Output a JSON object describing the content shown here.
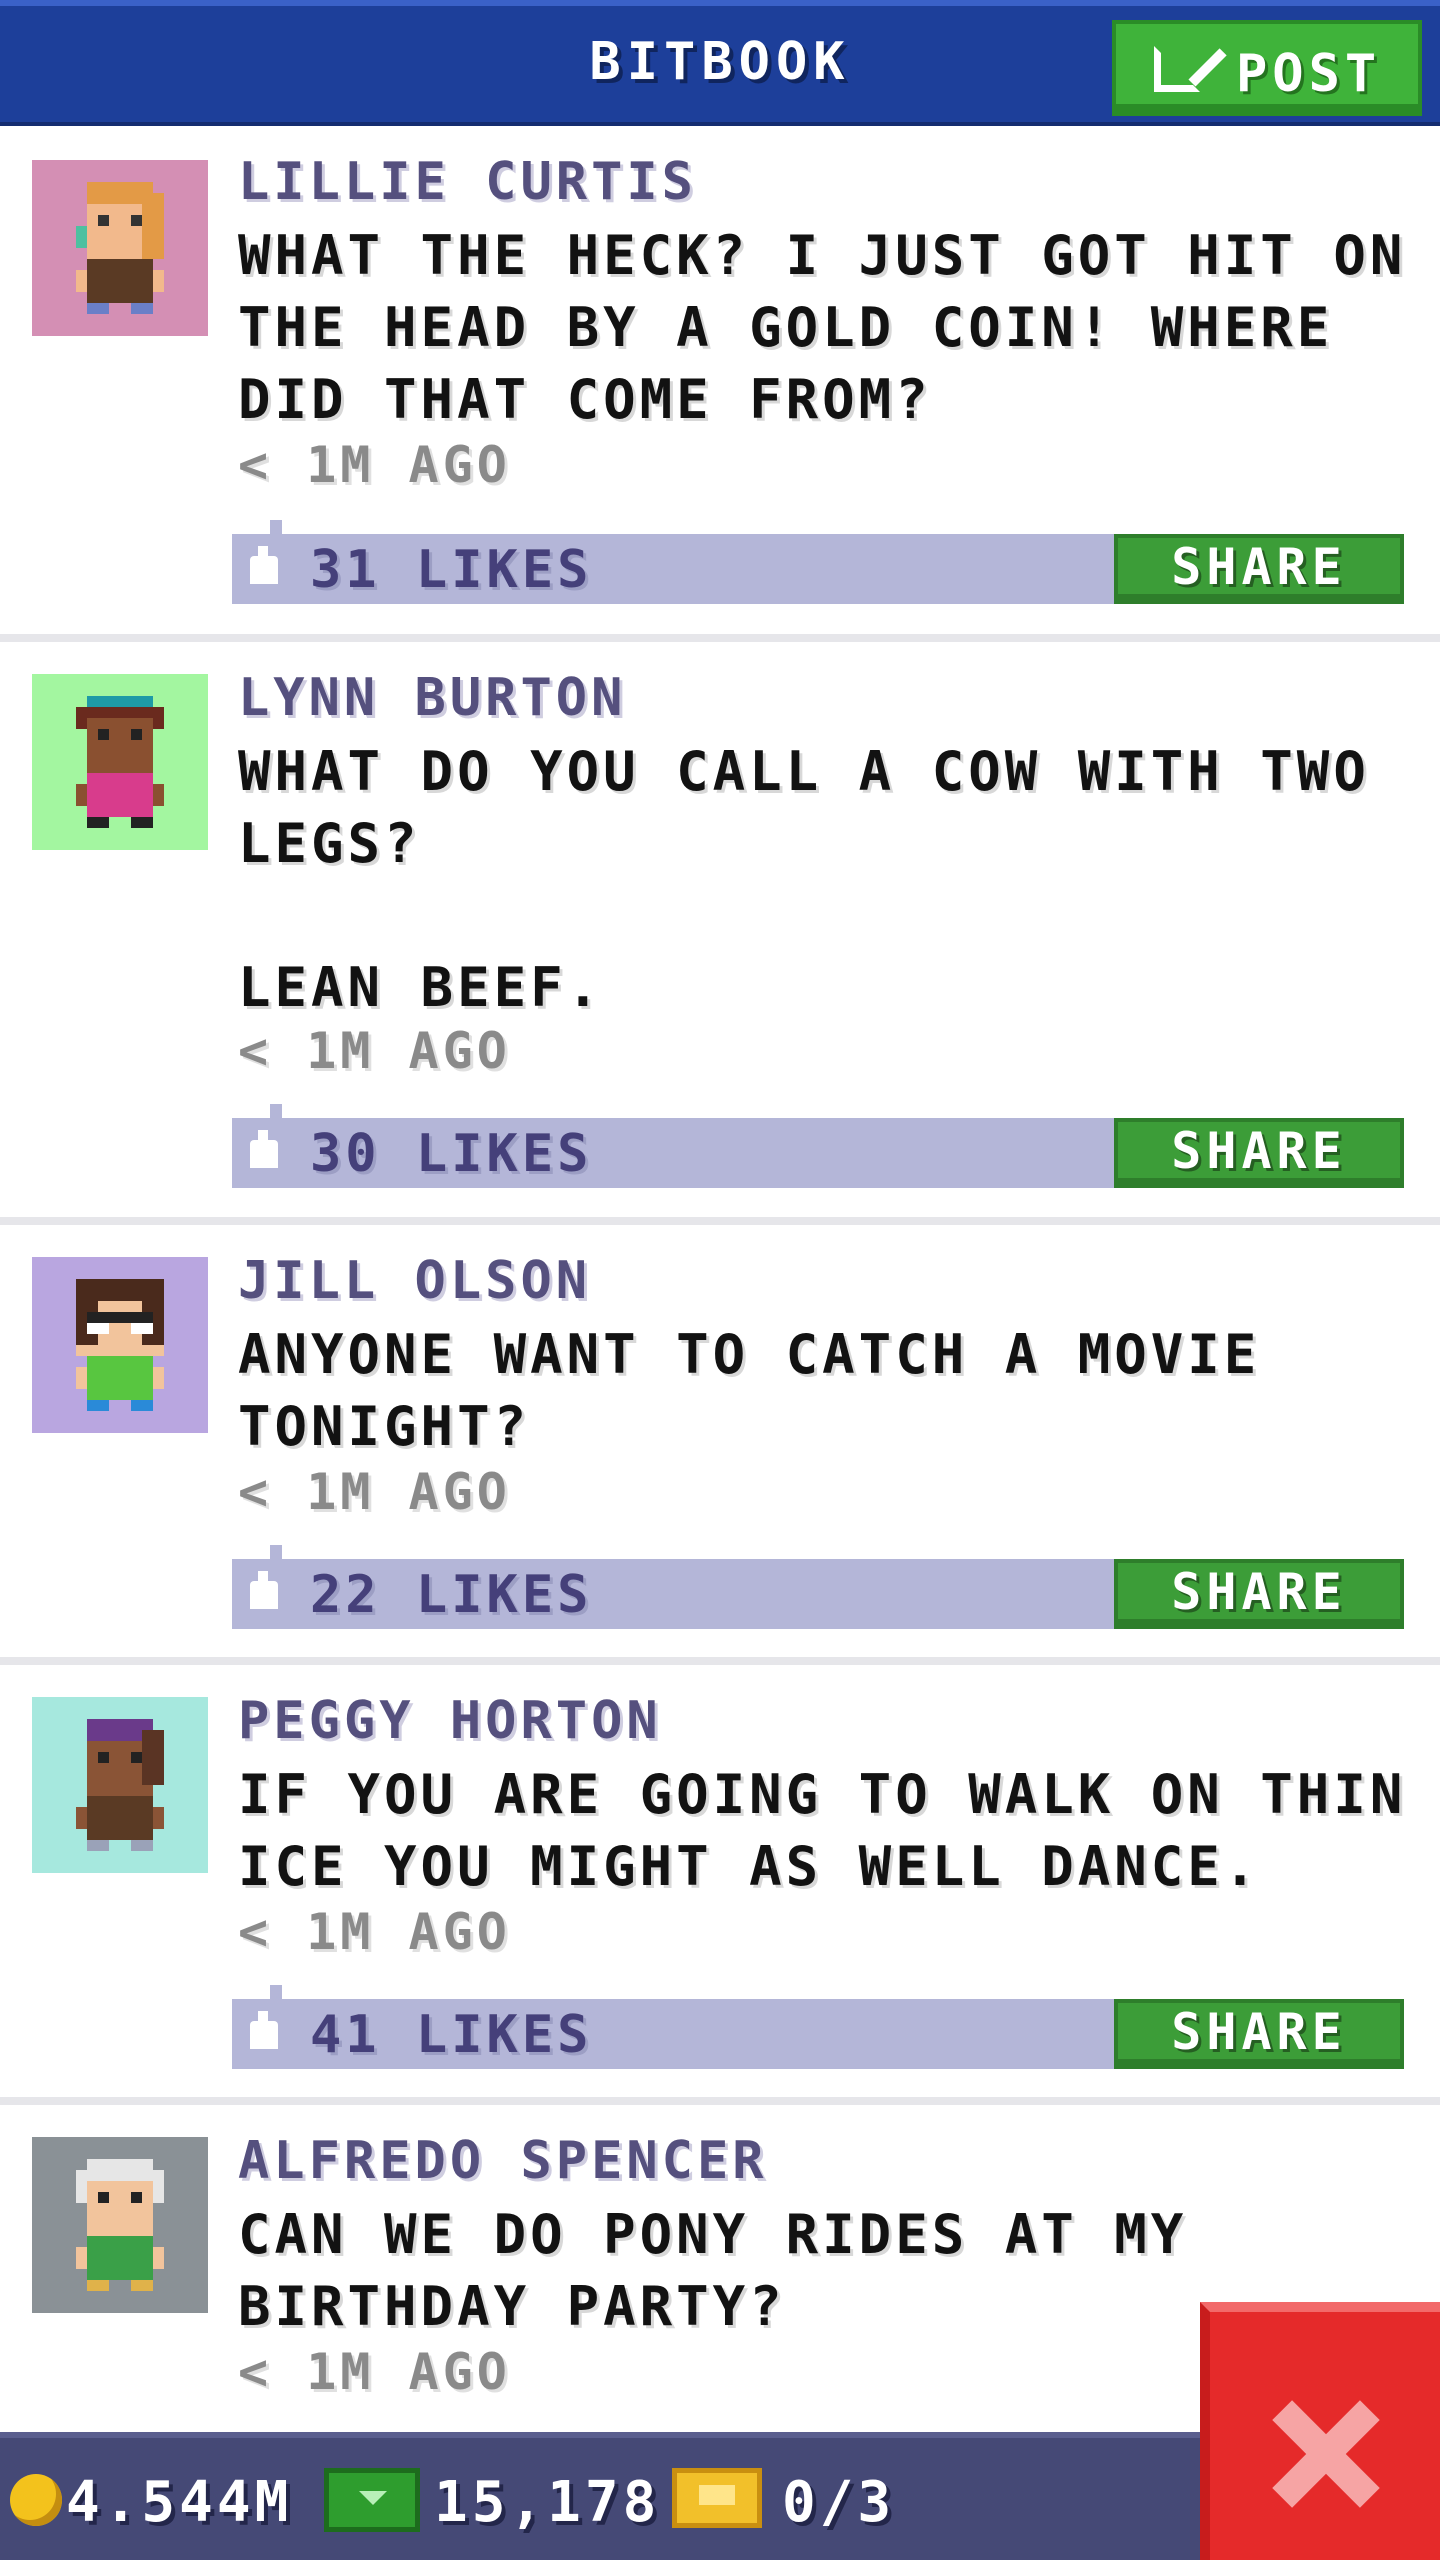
{
  "header": {
    "title": "BITBOOK",
    "post_button_label": "POST"
  },
  "posts": [
    {
      "author": "LILLIE CURTIS",
      "message": "WHAT THE HECK? I JUST GOT HIT ON THE HEAD BY A GOLD COIN! WHERE DID THAT COME FROM?",
      "time": "< 1M AGO",
      "likes": "31 LIKES",
      "share_label": "SHARE",
      "avatar_bg": "#d48fb4"
    },
    {
      "author": "LYNN BURTON",
      "message": "WHAT DO YOU CALL A COW WITH TWO LEGS?\n\nLEAN BEEF.",
      "time": "< 1M AGO",
      "likes": "30 LIKES",
      "share_label": "SHARE",
      "avatar_bg": "#a3f6a0"
    },
    {
      "author": "JILL OLSON",
      "message": "ANYONE WANT TO CATCH A MOVIE TONIGHT?",
      "time": "< 1M AGO",
      "likes": "22 LIKES",
      "share_label": "SHARE",
      "avatar_bg": "#b9a6e0"
    },
    {
      "author": "PEGGY HORTON",
      "message": "IF YOU ARE GOING TO WALK ON THIN ICE YOU MIGHT AS WELL DANCE.",
      "time": "< 1M AGO",
      "likes": "41 LIKES",
      "share_label": "SHARE",
      "avatar_bg": "#a6e8de"
    },
    {
      "author": "ALFREDO SPENCER",
      "message": "CAN WE DO PONY RIDES AT MY BIRTHDAY PARTY?",
      "time": "< 1M AGO",
      "avatar_bg": "#8a9196"
    }
  ],
  "status_bar": {
    "coins": "4.544M",
    "bux": "15,178",
    "tickets": "0/3"
  },
  "colors": {
    "header": "#1d3f9a",
    "share_green": "#3c9d38",
    "likes_bar": "#b4b6d8",
    "close_red": "#e52a2a"
  }
}
